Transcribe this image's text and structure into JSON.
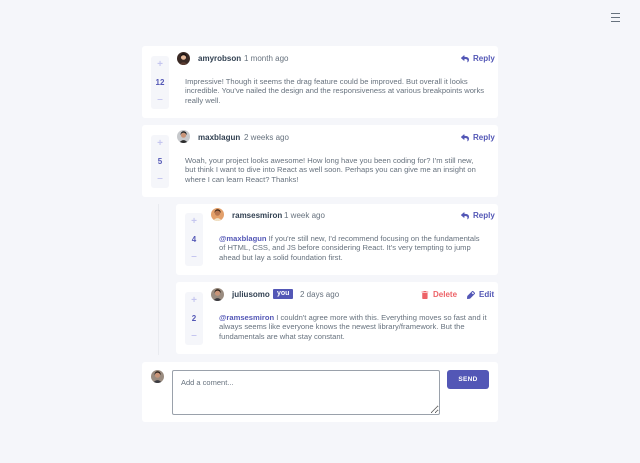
{
  "current_user": {
    "you_badge": "you"
  },
  "actions": {
    "reply": "Reply",
    "delete": "Delete",
    "edit": "Edit"
  },
  "vote_controls": {
    "plus": "+",
    "minus": "–"
  },
  "comments": [
    {
      "username": "amyrobson",
      "date": "1 month ago",
      "score": "12",
      "content": "Impressive! Though it seems the drag feature could be improved. But overall it looks incredible. You've nailed the design and the responsiveness at various breakpoints works really well."
    },
    {
      "username": "maxblagun",
      "date": "2 weeks ago",
      "score": "5",
      "content": "Woah, your project looks awesome! How long have you been coding for? I'm still new, but think I want to dive into React as well soon. Perhaps you can give me an insight on where I can learn React? Thanks!"
    }
  ],
  "replies": [
    {
      "username": "ramsesmiron",
      "date": "1 week ago",
      "score": "4",
      "mention": "@maxblagun",
      "content": " If you're still new, I'd recommend focusing on the fundamentals of HTML, CSS, and JS before considering React. It's very tempting to jump ahead but lay a solid foundation first."
    },
    {
      "username": "juliusomo",
      "date": "2 days ago",
      "score": "2",
      "mention": "@ramsesmiron",
      "content": " I couldn't agree more with this. Everything moves so fast and it always seems like everyone knows the newest library/framework. But the fundamentals are what stay constant."
    }
  ],
  "add_comment": {
    "placeholder": "Add a coment...",
    "send_label": "SEND"
  },
  "colors": {
    "accent": "#5357b6",
    "delete": "#ed6368",
    "background": "#f5f6fa",
    "vote_bg": "#f5f6fa"
  }
}
